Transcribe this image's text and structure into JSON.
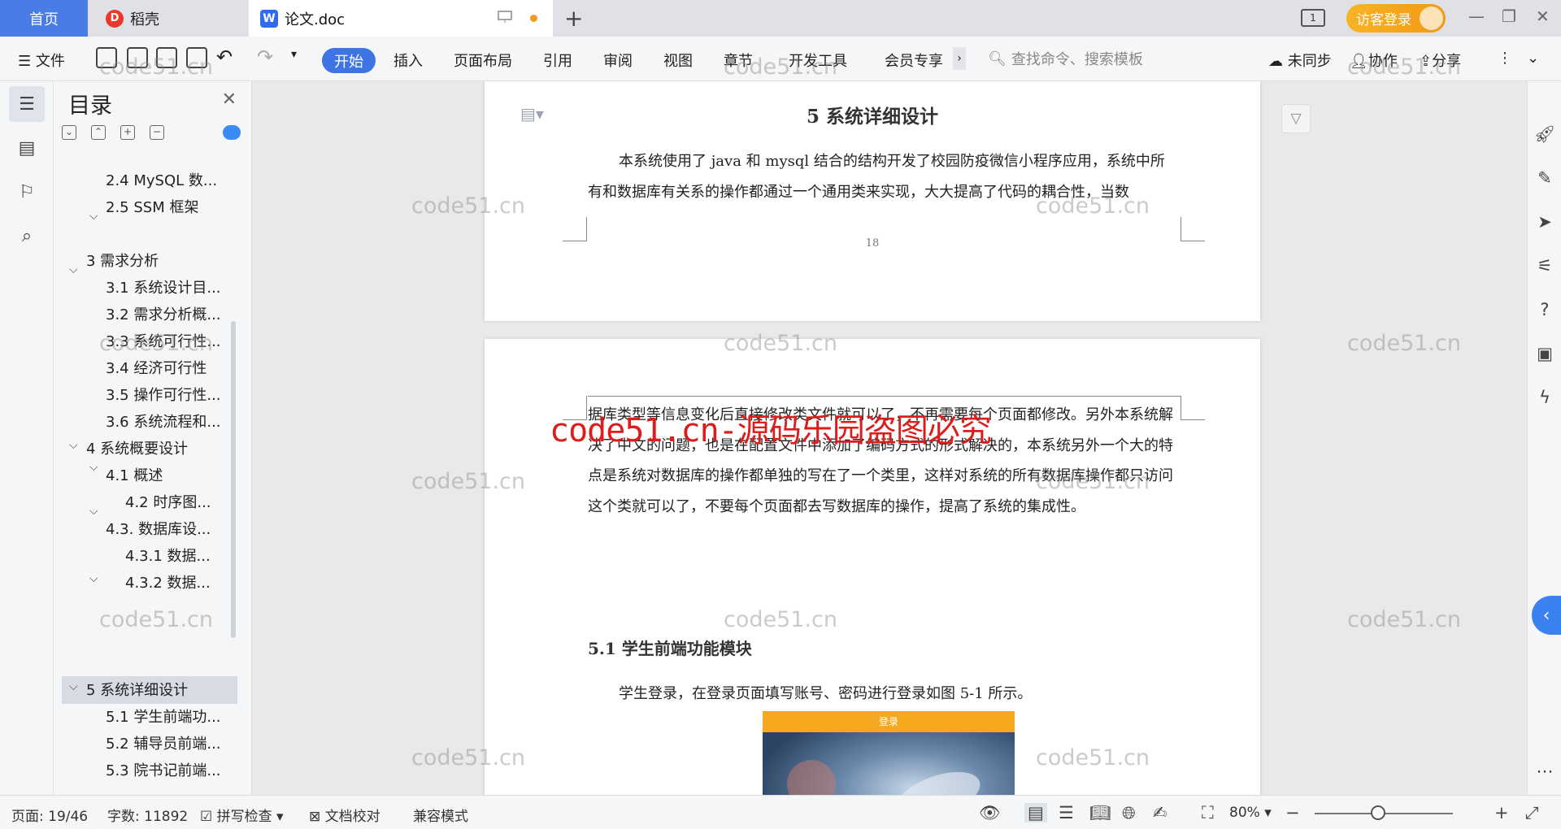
{
  "tabs": {
    "home": "首页",
    "docer": "稻壳",
    "document": "论文.doc",
    "new_tab": "+"
  },
  "titlebar": {
    "visitor_login": "访客登录"
  },
  "ribbon": {
    "file": "文件",
    "tabs": [
      "开始",
      "插入",
      "页面布局",
      "引用",
      "审阅",
      "视图",
      "章节",
      "开发工具",
      "会员专享"
    ],
    "search_placeholder": "查找命令、搜索模板",
    "sync": "未同步",
    "collab": "协作",
    "share": "分享"
  },
  "toc": {
    "title": "目录",
    "items": [
      {
        "text": "2.4 MySQL 数...",
        "level": 2
      },
      {
        "text": "2.5 SSM 框架",
        "level": 2
      },
      {
        "text": "3  需求分析",
        "level": 1
      },
      {
        "text": "3.1  系统设计目...",
        "level": 2
      },
      {
        "text": "3.2 需求分析概...",
        "level": 2
      },
      {
        "text": "3.3  系统可行性...",
        "level": 2
      },
      {
        "text": "3.4 经济可行性",
        "level": 2
      },
      {
        "text": "3.5 操作可行性...",
        "level": 2
      },
      {
        "text": "3.6 系统流程和...",
        "level": 2
      },
      {
        "text": "4 系统概要设计",
        "level": 1
      },
      {
        "text": "4.1  概述",
        "level": 2
      },
      {
        "text": "4.2  时序图...",
        "level": 3
      },
      {
        "text": "4.3.  数据库设...",
        "level": 2
      },
      {
        "text": "4.3.1  数据...",
        "level": 3
      },
      {
        "text": "4.3.2  数据...",
        "level": 3
      },
      {
        "text": "5 系统详细设计",
        "level": 1
      },
      {
        "text": "5.1 学生前端功...",
        "level": 2
      },
      {
        "text": "5.2 辅导员前端...",
        "level": 2
      },
      {
        "text": "5.3 院书记前端...",
        "level": 2
      }
    ]
  },
  "document": {
    "chapter_heading": "5 系统详细设计",
    "page1_text": "本系统使用了 java 和 mysql 结合的结构开发了校园防疫微信小程序应用，系统中所有和数据库有关系的操作都通过一个通用类来实现，大大提高了代码的耦合性，当数",
    "page_number": "18",
    "page2_text": "据库类型等信息变化后直接修改类文件就可以了，不再需要每个页面都修改。另外本系统解决了中文的问题，也是在配置文件中添加了编码方式的形式解决的，本系统另外一个大的特点是系统对数据库的操作都单独的写在了一个类里，这样对系统的所有数据库操作都只访问这个类就可以了，不要每个页面都去写数据库的操作，提高了系统的集成性。",
    "section_heading": "5.1 学生前端功能模块",
    "login_text": "学生登录，在登录页面填写账号、密码进行登录如图 5-1 所示。",
    "figure_bar": "登录"
  },
  "watermarks": {
    "site": "code51.cn",
    "warning": "code51.cn-源码乐园盗图必究"
  },
  "statusbar": {
    "page": "页面: 19/46",
    "words": "字数: 11892",
    "spell": "拼写检查",
    "proof": "文档校对",
    "compat": "兼容模式",
    "zoom": "80%"
  },
  "zoom_level_percent": 80,
  "colors": {
    "accent": "#3f74e4",
    "visitor": "#f5a623",
    "watermark_red": "#dd1c1c"
  }
}
